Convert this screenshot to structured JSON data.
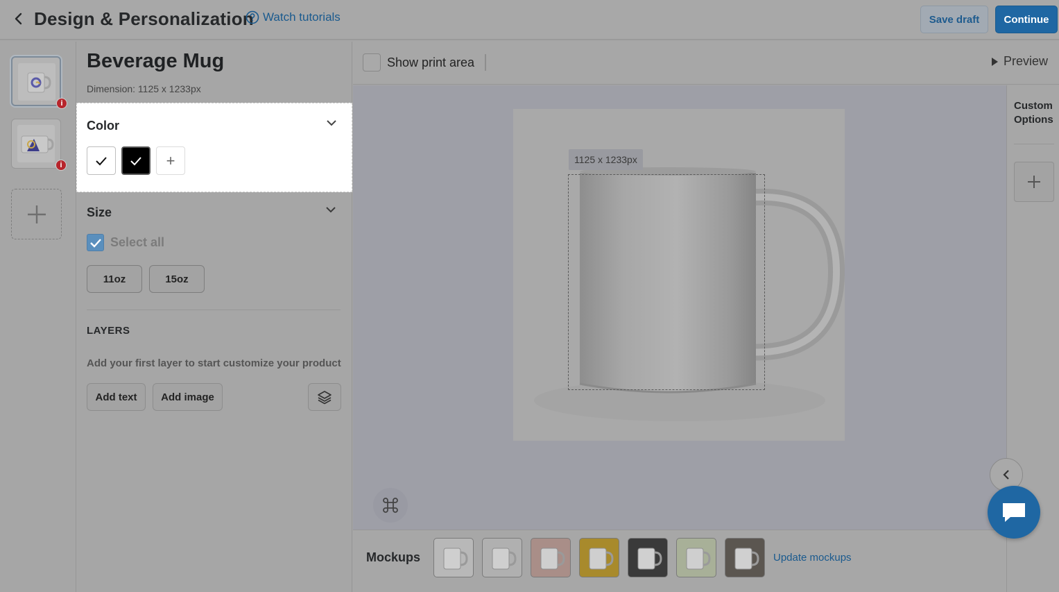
{
  "header": {
    "title": "Design & Personalization",
    "tutorials_label": "Watch tutorials",
    "save_draft_label": "Save draft",
    "continue_label": "Continue"
  },
  "product": {
    "name": "Beverage Mug",
    "dimension": "Dimension: 1125 x 1233px"
  },
  "color_section": {
    "title": "Color",
    "swatches": [
      {
        "name": "White",
        "hex": "#ffffff",
        "selected": true
      },
      {
        "name": "Black",
        "hex": "#000000",
        "selected": true
      }
    ],
    "add_label": "+"
  },
  "size_section": {
    "title": "Size",
    "select_all_label": "Select all",
    "select_all_checked": true,
    "sizes": [
      "11oz",
      "15oz"
    ]
  },
  "layers": {
    "title": "LAYERS",
    "hint": "Add your first layer to start customize your product",
    "add_text_label": "Add text",
    "add_image_label": "Add image"
  },
  "toolbar": {
    "show_print_area_label": "Show print area",
    "show_print_area_checked": false,
    "preview_label": "Preview"
  },
  "canvas": {
    "dimension_tag": "1125 x 1233px"
  },
  "mockups": {
    "label": "Mockups",
    "update_label": "Update mockups",
    "items": [
      {
        "icon": "mug-white-icon",
        "bg": "#b8b8b8"
      },
      {
        "icon": "mug-white-icon",
        "bg": "#b0b0b0"
      },
      {
        "icon": "mug-hands-icon",
        "bg": "#a98e88"
      },
      {
        "icon": "mug-yellow-icon",
        "bg": "#a88a2c"
      },
      {
        "icon": "mug-dark-icon",
        "bg": "#3a3a3a"
      },
      {
        "icon": "mug-plant-icon",
        "bg": "#a8b098"
      },
      {
        "icon": "mug-table-icon",
        "bg": "#5b5650"
      }
    ]
  },
  "right_rail": {
    "custom_options_label": "Custom Options"
  },
  "colors": {
    "primary": "#1f67a3",
    "link": "#1a5a8e",
    "error_badge": "#b7252c"
  }
}
